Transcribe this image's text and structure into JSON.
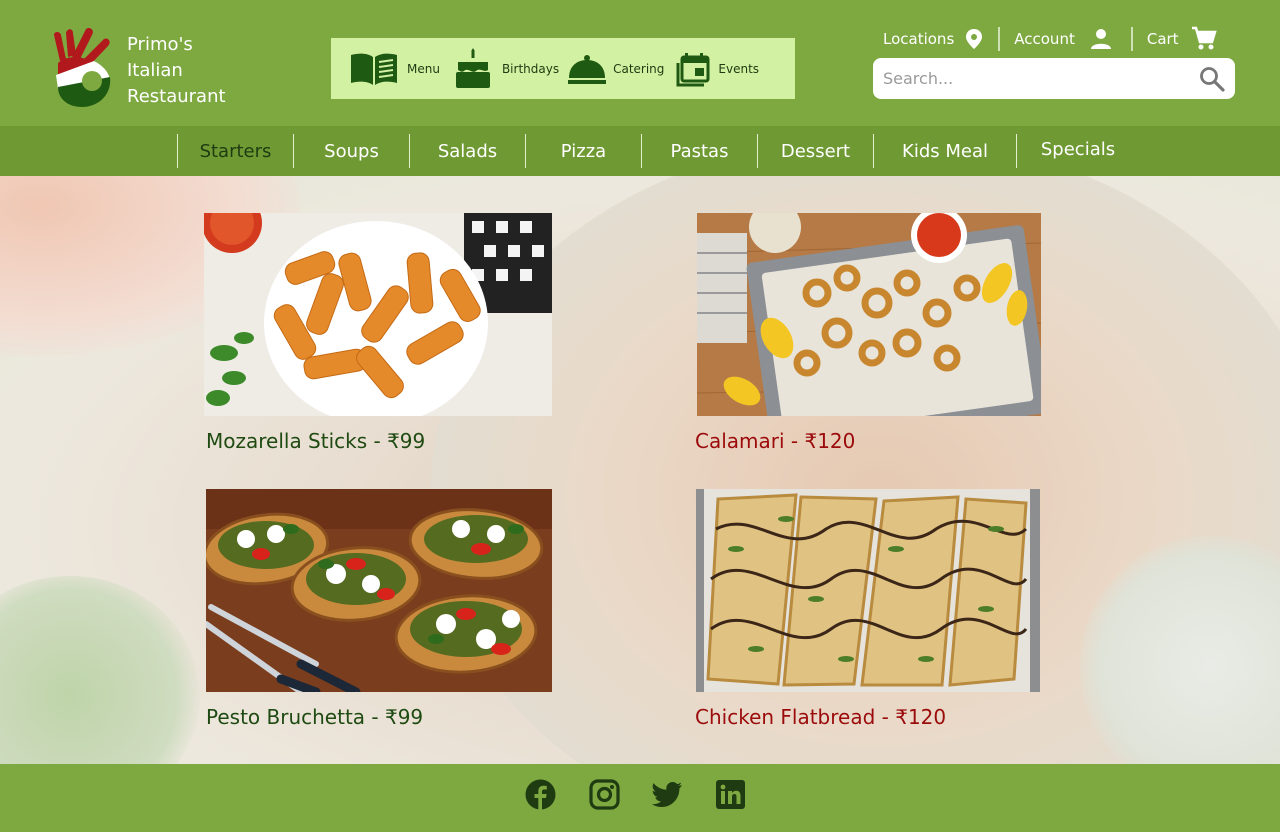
{
  "brand": {
    "line1": "Primo's",
    "line2": "Italian",
    "line3": "Restaurant"
  },
  "quicknav": [
    {
      "label": "Menu",
      "icon": "menu-book-icon"
    },
    {
      "label": "Birthdays",
      "icon": "cake-icon"
    },
    {
      "label": "Catering",
      "icon": "catering-cloche-icon"
    },
    {
      "label": "Events",
      "icon": "events-calendar-icon"
    }
  ],
  "toplinks": {
    "locations": "Locations",
    "account": "Account",
    "cart": "Cart"
  },
  "search": {
    "placeholder": "Search..."
  },
  "categories": [
    "Starters",
    "Soups",
    "Salads",
    "Pizza",
    "Pastas",
    "Dessert",
    "Kids Meal",
    "Specials"
  ],
  "active_category": "Starters",
  "items": [
    {
      "title": "Mozarella Sticks - ₹99",
      "caption_color": "green"
    },
    {
      "title": "Calamari - ₹120",
      "caption_color": "red"
    },
    {
      "title": "Pesto Bruchetta - ₹99",
      "caption_color": "green"
    },
    {
      "title": "Chicken Flatbread - ₹120",
      "caption_color": "red"
    }
  ],
  "footer": {
    "social": [
      "facebook-icon",
      "instagram-icon",
      "twitter-icon",
      "linkedin-icon"
    ]
  },
  "colors": {
    "header_green": "#7ea941",
    "category_bar": "#6f9a33",
    "quicknav_bg": "#d3f1a3",
    "dark_green_text": "#1f4a12",
    "red_text": "#9b0b0b"
  }
}
